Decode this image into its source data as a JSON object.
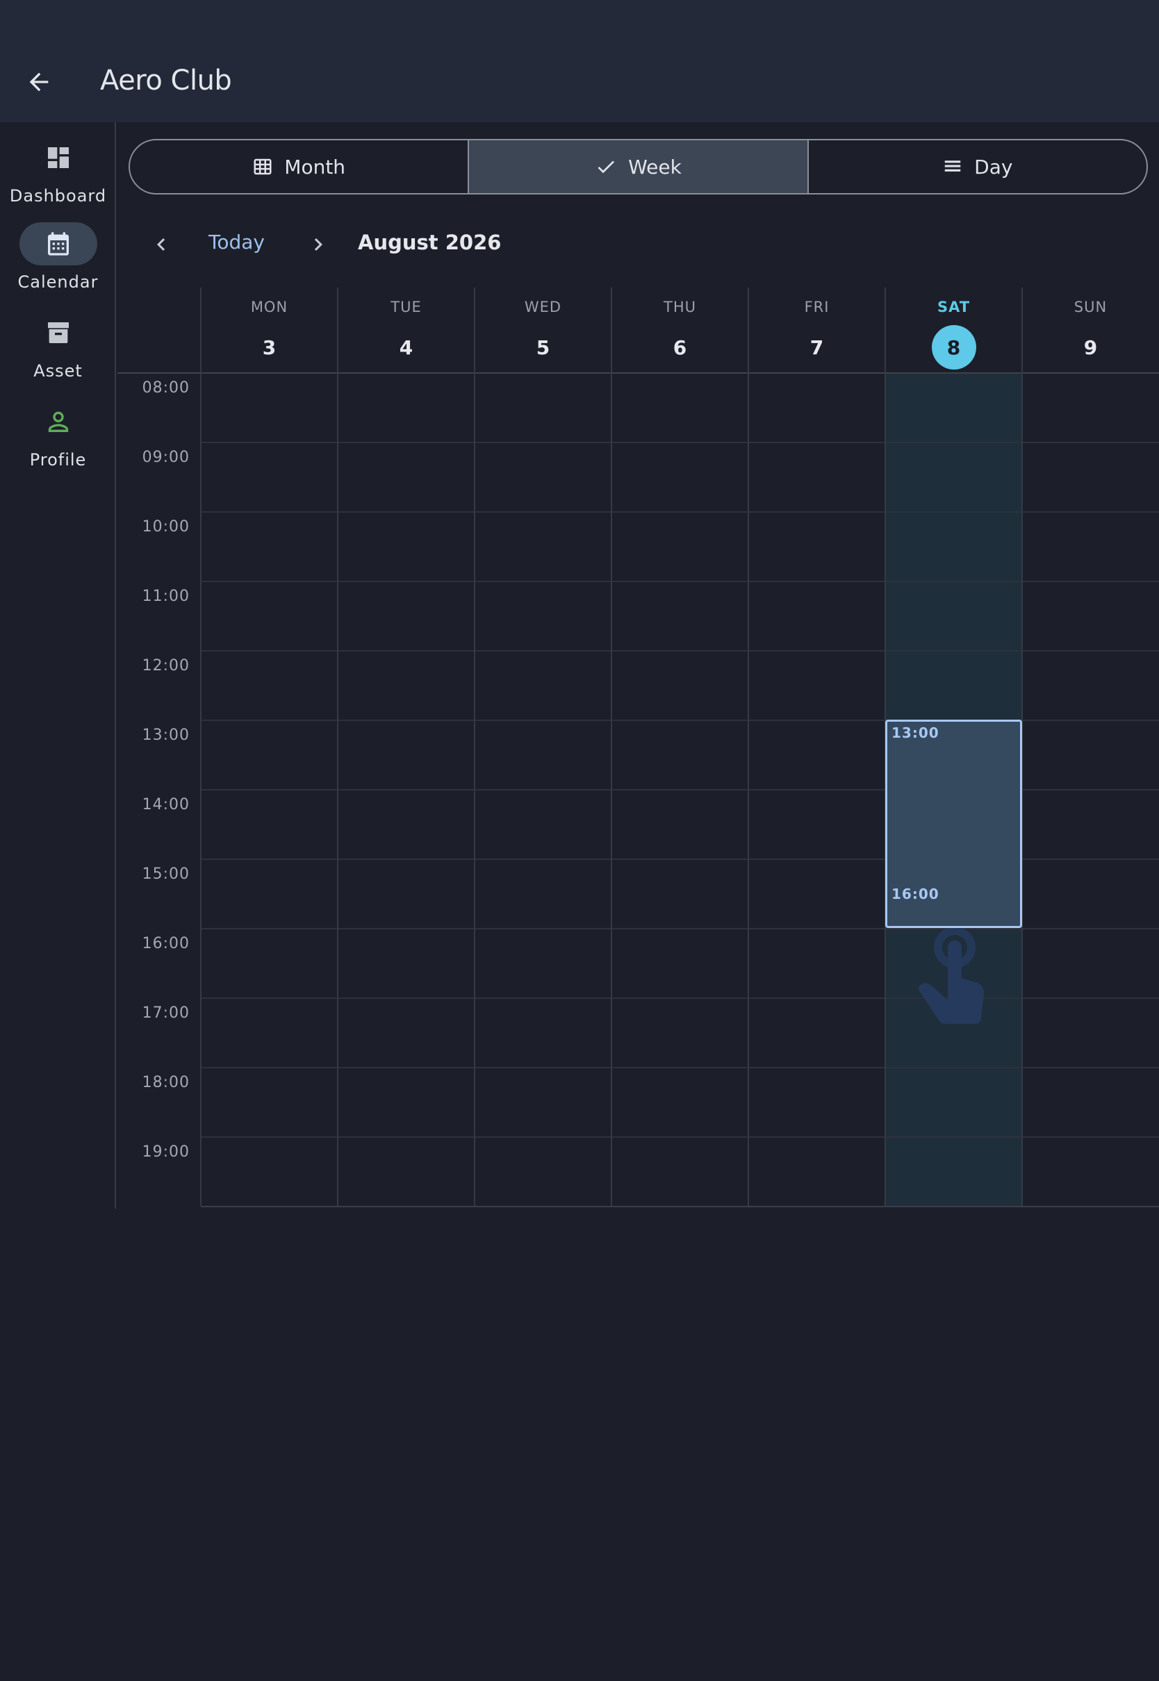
{
  "appbar": {
    "title": "Aero Club"
  },
  "rail": {
    "items": [
      {
        "label": "Dashboard",
        "icon": "dashboard-icon"
      },
      {
        "label": "Calendar",
        "icon": "calendar-icon",
        "active": true
      },
      {
        "label": "Asset",
        "icon": "archive-icon"
      },
      {
        "label": "Profile",
        "icon": "person-icon"
      }
    ]
  },
  "view_switcher": {
    "options": [
      {
        "label": "Month",
        "icon": "grid-icon"
      },
      {
        "label": "Week",
        "icon": "check-icon",
        "selected": true
      },
      {
        "label": "Day",
        "icon": "list-icon"
      }
    ]
  },
  "date_nav": {
    "today_label": "Today",
    "period": "August 2026"
  },
  "week": {
    "days": [
      {
        "dow": "MON",
        "date": "3"
      },
      {
        "dow": "TUE",
        "date": "4"
      },
      {
        "dow": "WED",
        "date": "5"
      },
      {
        "dow": "THU",
        "date": "6"
      },
      {
        "dow": "FRI",
        "date": "7"
      },
      {
        "dow": "SAT",
        "date": "8",
        "today": true
      },
      {
        "dow": "SUN",
        "date": "9"
      }
    ],
    "hours": [
      "08:00",
      "09:00",
      "10:00",
      "11:00",
      "12:00",
      "13:00",
      "14:00",
      "15:00",
      "16:00",
      "17:00",
      "18:00",
      "19:00"
    ]
  },
  "selection": {
    "day": "SAT",
    "start": "13:00",
    "end": "16:00"
  },
  "colors": {
    "accent": "#5ec9e8",
    "selection_border": "#a9c8f2",
    "profile_icon": "#5fae5a",
    "link": "#9dc0ec"
  }
}
